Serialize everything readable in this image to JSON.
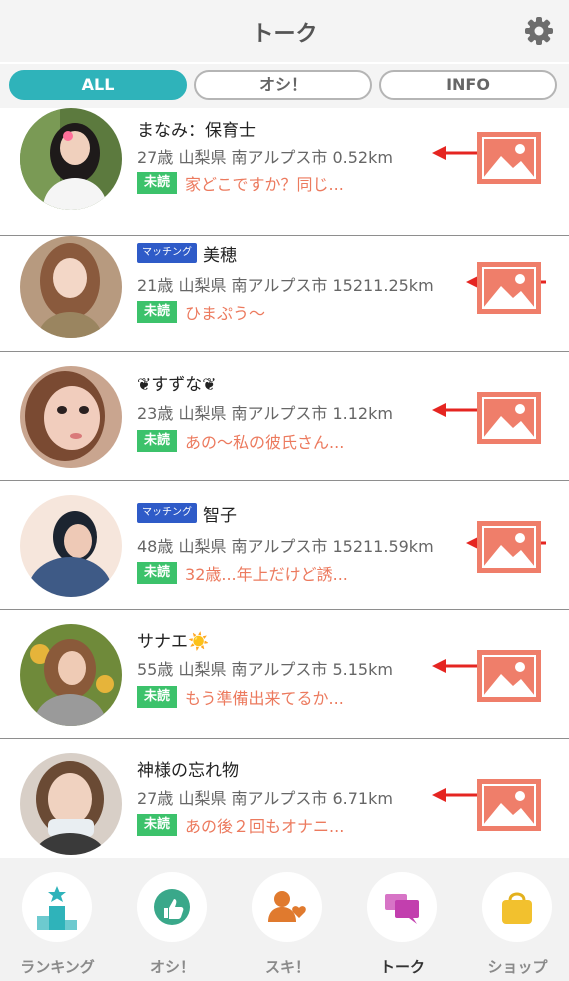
{
  "header": {
    "title": "トーク",
    "settings_icon": "gear-icon"
  },
  "tabs": [
    {
      "label": "ALL",
      "active": true
    },
    {
      "label": "オシ！",
      "active": false
    },
    {
      "label": "INFO",
      "active": false
    }
  ],
  "conversations": [
    {
      "name": "まなみ：保育士",
      "matching": false,
      "matching_label": "",
      "info": "27歳 山梨県 南アルプス市 0.52km",
      "unread_label": "未読",
      "message": "家どこですか？同じ..."
    },
    {
      "name": "美穂",
      "matching": true,
      "matching_label": "マッチング",
      "info": "21歳 山梨県 南アルプス市 15211.25km",
      "unread_label": "未読",
      "message": "ひまぷう〜"
    },
    {
      "name": "❦すずな❦",
      "matching": false,
      "matching_label": "",
      "info": "23歳 山梨県 南アルプス市 1.12km",
      "unread_label": "未読",
      "message": "あの〜私の彼氏さん..."
    },
    {
      "name": "智子",
      "matching": true,
      "matching_label": "マッチング",
      "info": "48歳 山梨県 南アルプス市 15211.59km",
      "unread_label": "未読",
      "message": "32歳...年上だけど誘..."
    },
    {
      "name": "サナエ☀️",
      "matching": false,
      "matching_label": "",
      "info": "55歳 山梨県 南アルプス市 5.15km",
      "unread_label": "未読",
      "message": "もう準備出来てるか..."
    },
    {
      "name": "神様の忘れ物",
      "matching": false,
      "matching_label": "",
      "info": "27歳 山梨県 南アルプス市 6.71km",
      "unread_label": "未読",
      "message": "あの後２回もオナニ..."
    }
  ],
  "bottom_nav": [
    {
      "label": "ランキング",
      "icon": "ranking-podium-icon",
      "active": false
    },
    {
      "label": "オシ！",
      "icon": "thumbs-up-icon",
      "active": false
    },
    {
      "label": "スキ！",
      "icon": "person-heart-icon",
      "active": false
    },
    {
      "label": "トーク",
      "icon": "chat-bubbles-icon",
      "active": true
    },
    {
      "label": "ショップ",
      "icon": "shopping-bag-icon",
      "active": false
    }
  ],
  "colors": {
    "accent": "#2fb3ba",
    "unread": "#3cc26b",
    "matching": "#2f5bc8",
    "message": "#ec7a5e",
    "photo_button": "#ef7e6a",
    "arrow": "#e52521"
  }
}
